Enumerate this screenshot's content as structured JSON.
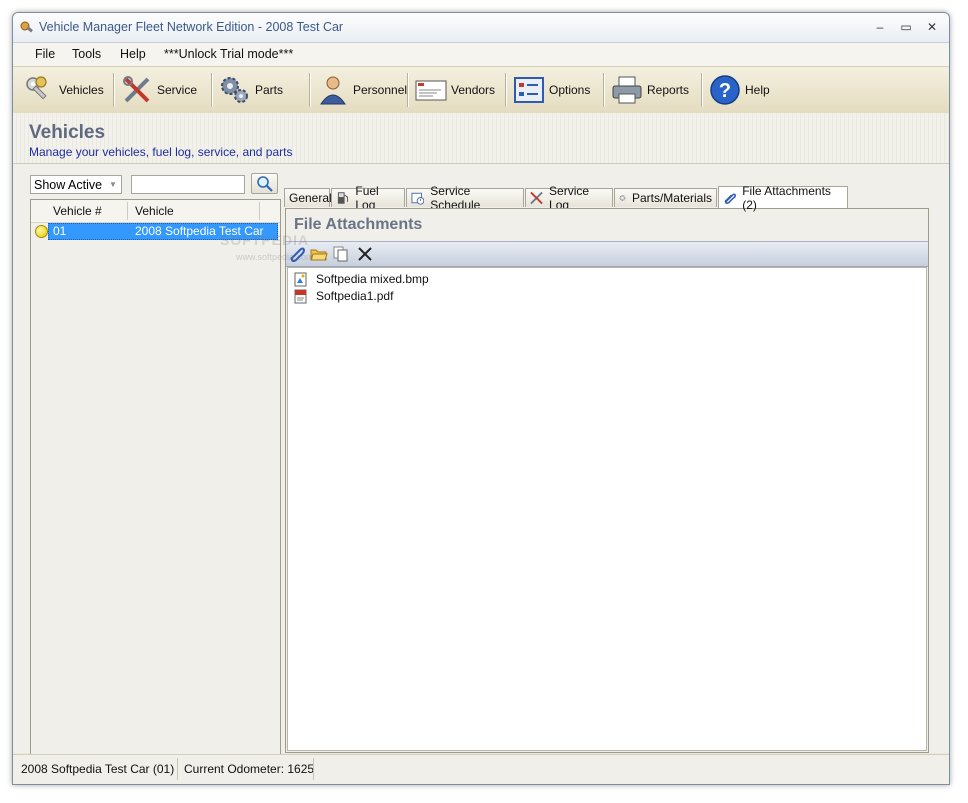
{
  "window": {
    "title": "Vehicle Manager Fleet Network Edition - 2008 Test Car"
  },
  "menu": [
    "File",
    "Tools",
    "Help",
    "***Unlock Trial mode***"
  ],
  "toolbar": {
    "vehicles": "Vehicles",
    "service": "Service",
    "parts": "Parts",
    "personnel": "Personnel",
    "vendors": "Vendors",
    "options": "Options",
    "reports": "Reports",
    "help": "Help"
  },
  "header": {
    "title": "Vehicles",
    "subtitle": "Manage your vehicles, fuel log, service, and parts"
  },
  "filter": {
    "selected": "Show Active",
    "search_value": ""
  },
  "vehicle_list": {
    "columns": [
      "Vehicle #",
      "Vehicle"
    ],
    "rows": [
      {
        "number": "01",
        "vehicle": "2008 Softpedia Test Car",
        "selected": true
      }
    ]
  },
  "tabs": [
    "General",
    "Fuel Log",
    "Service Schedule",
    "Service Log",
    "Parts/Materials",
    "File Attachments (2)"
  ],
  "active_tab": "File Attachments (2)",
  "panel": {
    "title": "File Attachments"
  },
  "files": [
    {
      "name": "Softpedia mixed.bmp",
      "icon": "bmp-file-icon"
    },
    {
      "name": "Softpedia1.pdf",
      "icon": "pdf-file-icon"
    }
  ],
  "status": {
    "vehicle": "2008 Softpedia Test Car (01)",
    "odometer": "Current Odometer: 1625"
  },
  "watermark": {
    "brand": "SOFTPEDIA",
    "url": "www.softpedia.com"
  },
  "colors": {
    "selection": "#3399ff",
    "subtitle": "#1e2e9e",
    "title": "#5d6a80"
  }
}
